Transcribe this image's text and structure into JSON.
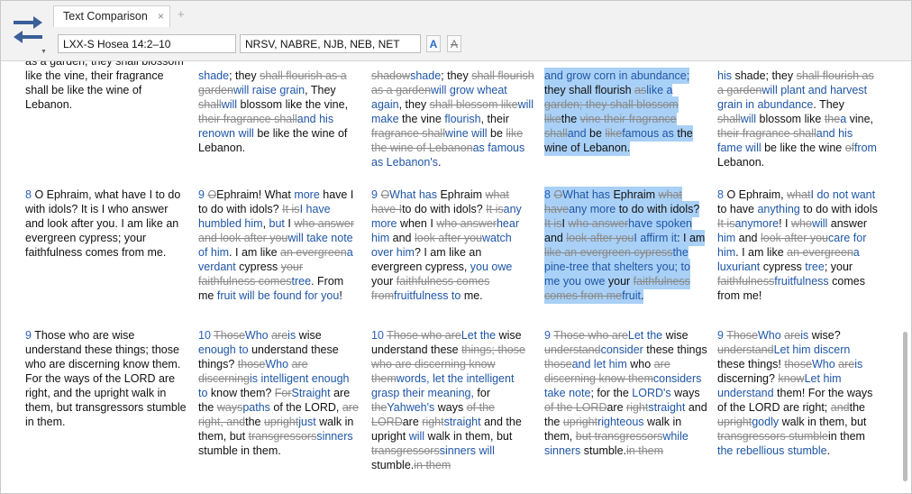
{
  "tab": {
    "title": "Text Comparison",
    "close_glyph": "×",
    "add_glyph": "+"
  },
  "toolbar": {
    "reference": "LXX-S Hosea 14:2–10",
    "versions": "NRSV, NABRE, NJB, NEB, NET",
    "bold_btn": "A",
    "strike_btn": "A",
    "menu_glyph": "▼"
  },
  "columns": [
    {
      "cells": [
        [
          {
            "t": "as a garden; they shall blossom like the vine, their fragrance shall be like the wine of Lebanon."
          }
        ],
        [
          {
            "t": "8 ",
            "k": "vn"
          },
          {
            "t": "O Ephraim, what have I to do with idols? It is I who answer and look after you. I am like an evergreen cypress; your faithfulness comes from me."
          }
        ],
        [
          {
            "t": "9 ",
            "k": "vn"
          },
          {
            "t": "Those who are wise understand these things; those who are discerning know them. For the ways of the LORD are right, and the upright walk in them, but transgressors stumble in them."
          }
        ]
      ]
    },
    {
      "cells": [
        [
          {
            "t": "shade",
            "k": "ins"
          },
          {
            "t": "; they "
          },
          {
            "t": "shall flourish as a garden",
            "k": "del"
          },
          {
            "t": "will raise grain",
            "k": "ins"
          },
          {
            "t": ", They "
          },
          {
            "t": "shall",
            "k": "del"
          },
          {
            "t": "will",
            "k": "ins"
          },
          {
            "t": " blossom like the vine, "
          },
          {
            "t": "their fragrance shall",
            "k": "del"
          },
          {
            "t": "and his renown will",
            "k": "ins"
          },
          {
            "t": " be like the wine of Lebanon."
          }
        ],
        [
          {
            "t": "9 ",
            "k": "vn"
          },
          {
            "t": "O",
            "k": "del"
          },
          {
            "t": "Ephraim! What "
          },
          {
            "t": "more",
            "k": "ins"
          },
          {
            "t": " have I to do with idols? "
          },
          {
            "t": "It is",
            "k": "del"
          },
          {
            "t": "I have humbled him",
            "k": "ins"
          },
          {
            "t": ", "
          },
          {
            "t": "but",
            "k": "ins"
          },
          {
            "t": " I "
          },
          {
            "t": "who answer and look after you",
            "k": "del"
          },
          {
            "t": "will take note of him",
            "k": "ins"
          },
          {
            "t": ". I am like "
          },
          {
            "t": "an evergreen",
            "k": "del"
          },
          {
            "t": "a verdant",
            "k": "ins"
          },
          {
            "t": " cypress "
          },
          {
            "t": "your faithfulness comes",
            "k": "del"
          },
          {
            "t": "tree",
            "k": "ins"
          },
          {
            "t": ". From me "
          },
          {
            "t": "fruit will be found for you",
            "k": "ins"
          },
          {
            "t": "!"
          }
        ],
        [
          {
            "t": "10 ",
            "k": "vn"
          },
          {
            "t": "Those",
            "k": "del"
          },
          {
            "t": "Who",
            "k": "ins"
          },
          {
            "t": " "
          },
          {
            "t": "are",
            "k": "del"
          },
          {
            "t": "is",
            "k": "ins"
          },
          {
            "t": " wise "
          },
          {
            "t": "enough to",
            "k": "ins"
          },
          {
            "t": " understand these things? "
          },
          {
            "t": "those",
            "k": "del"
          },
          {
            "t": "Who",
            "k": "ins"
          },
          {
            "t": " "
          },
          {
            "t": "are discerning",
            "k": "del"
          },
          {
            "t": "is intelligent enough to",
            "k": "ins"
          },
          {
            "t": " know them? "
          },
          {
            "t": "For",
            "k": "del"
          },
          {
            "t": "Straight",
            "k": "ins"
          },
          {
            "t": " are the "
          },
          {
            "t": "ways",
            "k": "del"
          },
          {
            "t": "paths",
            "k": "ins"
          },
          {
            "t": " of the LORD, "
          },
          {
            "t": "are right, and",
            "k": "del"
          },
          {
            "t": "the "
          },
          {
            "t": "upright",
            "k": "del"
          },
          {
            "t": "just",
            "k": "ins"
          },
          {
            "t": " walk in them, but "
          },
          {
            "t": "transgressors",
            "k": "del"
          },
          {
            "t": "sinners",
            "k": "ins"
          },
          {
            "t": " stumble in them."
          }
        ]
      ]
    },
    {
      "cells": [
        [
          {
            "t": "shadow",
            "k": "del"
          },
          {
            "t": "shade",
            "k": "ins"
          },
          {
            "t": "; they "
          },
          {
            "t": "shall flourish as a garden",
            "k": "del"
          },
          {
            "t": "will grow wheat again",
            "k": "ins"
          },
          {
            "t": ", they "
          },
          {
            "t": "shall blossom like",
            "k": "del"
          },
          {
            "t": "will make",
            "k": "ins"
          },
          {
            "t": " the vine "
          },
          {
            "t": "flourish",
            "k": "ins"
          },
          {
            "t": ", their "
          },
          {
            "t": "fragrance shall",
            "k": "del"
          },
          {
            "t": "wine will",
            "k": "ins"
          },
          {
            "t": " be "
          },
          {
            "t": "like the wine of Lebanon",
            "k": "del"
          },
          {
            "t": "as famous as Lebanon's",
            "k": "ins"
          },
          {
            "t": "."
          }
        ],
        [
          {
            "t": "9 ",
            "k": "vn"
          },
          {
            "t": "O",
            "k": "del"
          },
          {
            "t": "What has",
            "k": "ins"
          },
          {
            "t": " Ephraim "
          },
          {
            "t": "what have I",
            "k": "del"
          },
          {
            "t": "to do with idols? "
          },
          {
            "t": "It is",
            "k": "del"
          },
          {
            "t": "any more",
            "k": "ins"
          },
          {
            "t": " when I "
          },
          {
            "t": "who answer",
            "k": "del"
          },
          {
            "t": "hear him",
            "k": "ins"
          },
          {
            "t": " and "
          },
          {
            "t": "look after you",
            "k": "del"
          },
          {
            "t": "watch over him",
            "k": "ins"
          },
          {
            "t": "? I am like an evergreen cypress, "
          },
          {
            "t": "you owe",
            "k": "ins"
          },
          {
            "t": " your "
          },
          {
            "t": "faithfulness comes from",
            "k": "del"
          },
          {
            "t": "fruitfulness to",
            "k": "ins"
          },
          {
            "t": " me."
          }
        ],
        [
          {
            "t": "10 ",
            "k": "vn"
          },
          {
            "t": "Those who are",
            "k": "del"
          },
          {
            "t": "Let the",
            "k": "ins"
          },
          {
            "t": " wise understand these "
          },
          {
            "t": "things; those who are discerning know them",
            "k": "del"
          },
          {
            "t": "words, let the intelligent grasp their meaning,",
            "k": "ins"
          },
          {
            "t": " for "
          },
          {
            "t": "the",
            "k": "del"
          },
          {
            "t": "Yahweh's",
            "k": "ins"
          },
          {
            "t": " ways "
          },
          {
            "t": "of the LORD",
            "k": "del"
          },
          {
            "t": "are "
          },
          {
            "t": "right",
            "k": "del"
          },
          {
            "t": "straight",
            "k": "ins"
          },
          {
            "t": " and the upright "
          },
          {
            "t": "will",
            "k": "ins"
          },
          {
            "t": " walk in them, but "
          },
          {
            "t": "transgressors",
            "k": "del"
          },
          {
            "t": "sinners will",
            "k": "ins"
          },
          {
            "t": " stumble."
          },
          {
            "t": "in them",
            "k": "del"
          }
        ]
      ]
    },
    {
      "cells": [
        [
          {
            "t": "and grow corn in abundance;",
            "k": "ins"
          },
          {
            "t": " they shall flourish "
          },
          {
            "t": "as",
            "k": "del"
          },
          {
            "t": "like a",
            "k": "ins"
          },
          {
            "t": " "
          },
          {
            "t": "garden; they shall blossom like",
            "k": "del"
          },
          {
            "t": "the "
          },
          {
            "t": "vine their fragrance shall",
            "k": "del"
          },
          {
            "t": "and",
            "k": "ins"
          },
          {
            "t": " be "
          },
          {
            "t": "like",
            "k": "del"
          },
          {
            "t": "famous as",
            "k": "ins"
          },
          {
            "t": " the wine of Lebanon."
          }
        ],
        [
          {
            "t": "8 ",
            "k": "vn"
          },
          {
            "t": "O",
            "k": "del"
          },
          {
            "t": "What has",
            "k": "ins"
          },
          {
            "t": " Ephraim "
          },
          {
            "t": "what have",
            "k": "del"
          },
          {
            "t": "any more",
            "k": "ins"
          },
          {
            "t": " to do with idols? "
          },
          {
            "t": "It is",
            "k": "del"
          },
          {
            "t": "I "
          },
          {
            "t": "who answer",
            "k": "del"
          },
          {
            "t": "have spoken",
            "k": "ins"
          },
          {
            "t": " and "
          },
          {
            "t": "look after you",
            "k": "del"
          },
          {
            "t": "I affirm it",
            "k": "ins"
          },
          {
            "t": ": I am "
          },
          {
            "t": "like an evergreen cypress",
            "k": "del"
          },
          {
            "t": "the pine-tree that shelters you; to me you owe",
            "k": "ins"
          },
          {
            "t": " your "
          },
          {
            "t": "faithfulness comes from me",
            "k": "del"
          },
          {
            "t": "fruit",
            "k": "ins"
          },
          {
            "t": "."
          }
        ],
        [
          {
            "t": "9 ",
            "k": "vn"
          },
          {
            "t": "Those who are",
            "k": "del"
          },
          {
            "t": "Let the",
            "k": "ins"
          },
          {
            "t": " wise "
          },
          {
            "t": "understand",
            "k": "del"
          },
          {
            "t": "consider",
            "k": "ins"
          },
          {
            "t": " these things "
          },
          {
            "t": "those",
            "k": "del"
          },
          {
            "t": "and let him",
            "k": "ins"
          },
          {
            "t": " who "
          },
          {
            "t": "are discerning know them",
            "k": "del"
          },
          {
            "t": "considers take note",
            "k": "ins"
          },
          {
            "t": "; for the "
          },
          {
            "t": "LORD's",
            "k": "ins"
          },
          {
            "t": " ways "
          },
          {
            "t": "of the LORD",
            "k": "del"
          },
          {
            "t": "are "
          },
          {
            "t": "right",
            "k": "del"
          },
          {
            "t": "straight",
            "k": "ins"
          },
          {
            "t": " and the "
          },
          {
            "t": "upright",
            "k": "del"
          },
          {
            "t": "righteous",
            "k": "ins"
          },
          {
            "t": " walk in them, "
          },
          {
            "t": "but transgressors",
            "k": "del"
          },
          {
            "t": "while sinners",
            "k": "ins"
          },
          {
            "t": " stumble."
          },
          {
            "t": "in them",
            "k": "del"
          }
        ]
      ]
    },
    {
      "cells": [
        [
          {
            "t": "his",
            "k": "ins"
          },
          {
            "t": " shade; they "
          },
          {
            "t": "shall flourish as a garden",
            "k": "del"
          },
          {
            "t": "will plant and harvest grain in abundance",
            "k": "ins"
          },
          {
            "t": ". They "
          },
          {
            "t": "shall",
            "k": "del"
          },
          {
            "t": "will",
            "k": "ins"
          },
          {
            "t": " blossom like "
          },
          {
            "t": "the",
            "k": "del"
          },
          {
            "t": "a",
            "k": "ins"
          },
          {
            "t": " vine, "
          },
          {
            "t": "their fragrance shall",
            "k": "del"
          },
          {
            "t": "and his fame will",
            "k": "ins"
          },
          {
            "t": " be like the wine "
          },
          {
            "t": "of",
            "k": "del"
          },
          {
            "t": "from",
            "k": "ins"
          },
          {
            "t": " Lebanon."
          }
        ],
        [
          {
            "t": "8 ",
            "k": "vn"
          },
          {
            "t": "O Ephraim, "
          },
          {
            "t": "what",
            "k": "del"
          },
          {
            "t": "I do not want",
            "k": "ins"
          },
          {
            "t": " to have "
          },
          {
            "t": "anything",
            "k": "ins"
          },
          {
            "t": " to do with idols "
          },
          {
            "t": "It is",
            "k": "del"
          },
          {
            "t": "anymore",
            "k": "ins"
          },
          {
            "t": "! I "
          },
          {
            "t": "who",
            "k": "del"
          },
          {
            "t": "will",
            "k": "ins"
          },
          {
            "t": " answer "
          },
          {
            "t": "him",
            "k": "ins"
          },
          {
            "t": " and "
          },
          {
            "t": "look after you",
            "k": "del"
          },
          {
            "t": "care for him",
            "k": "ins"
          },
          {
            "t": ". I am like "
          },
          {
            "t": "an evergreen",
            "k": "del"
          },
          {
            "t": "a luxuriant",
            "k": "ins"
          },
          {
            "t": " cypress "
          },
          {
            "t": "tree",
            "k": "ins"
          },
          {
            "t": "; your "
          },
          {
            "t": "faithfulness",
            "k": "del"
          },
          {
            "t": "fruitfulness",
            "k": "ins"
          },
          {
            "t": " comes from me!"
          }
        ],
        [
          {
            "t": "9 ",
            "k": "vn"
          },
          {
            "t": "Those",
            "k": "del"
          },
          {
            "t": "Who",
            "k": "ins"
          },
          {
            "t": " "
          },
          {
            "t": "are",
            "k": "del"
          },
          {
            "t": "is",
            "k": "ins"
          },
          {
            "t": " wise? "
          },
          {
            "t": "understand",
            "k": "del"
          },
          {
            "t": "Let him discern",
            "k": "ins"
          },
          {
            "t": " these things! "
          },
          {
            "t": "those",
            "k": "del"
          },
          {
            "t": "Who",
            "k": "ins"
          },
          {
            "t": " "
          },
          {
            "t": "are",
            "k": "del"
          },
          {
            "t": "is",
            "k": "ins"
          },
          {
            "t": " discerning? "
          },
          {
            "t": "know",
            "k": "del"
          },
          {
            "t": "Let him understand",
            "k": "ins"
          },
          {
            "t": " them! For the ways of the LORD are right; "
          },
          {
            "t": "and",
            "k": "del"
          },
          {
            "t": "the "
          },
          {
            "t": "upright",
            "k": "del"
          },
          {
            "t": "godly",
            "k": "ins"
          },
          {
            "t": " walk in them, but "
          },
          {
            "t": "transgressors stumble",
            "k": "del"
          },
          {
            "t": "in them "
          },
          {
            "t": "the rebellious stumble",
            "k": "ins"
          },
          {
            "t": "."
          }
        ]
      ]
    }
  ]
}
